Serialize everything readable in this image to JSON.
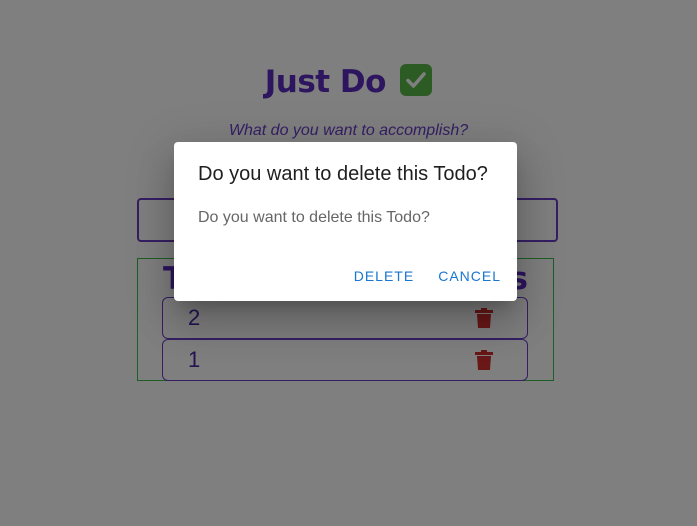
{
  "app": {
    "title": "Just Do",
    "title_icon": "check-mark-button-icon",
    "subtitle": "What do you want to accomplish?",
    "input_placeholder": "",
    "list_heading_left": "T",
    "list_heading_right": "s",
    "todos": [
      {
        "text": "2",
        "delete_icon": "trash-icon"
      },
      {
        "text": "1",
        "delete_icon": "trash-icon"
      }
    ],
    "colors": {
      "primary": "#5b2bbf",
      "list_border": "#3bbf49",
      "delete": "#d32f2f",
      "dialog_button": "#1976d2"
    }
  },
  "dialog": {
    "title": "Do you want to delete this Todo?",
    "content": "Do you want to delete this Todo?",
    "confirm_label": "DELETE",
    "cancel_label": "CANCEL"
  }
}
